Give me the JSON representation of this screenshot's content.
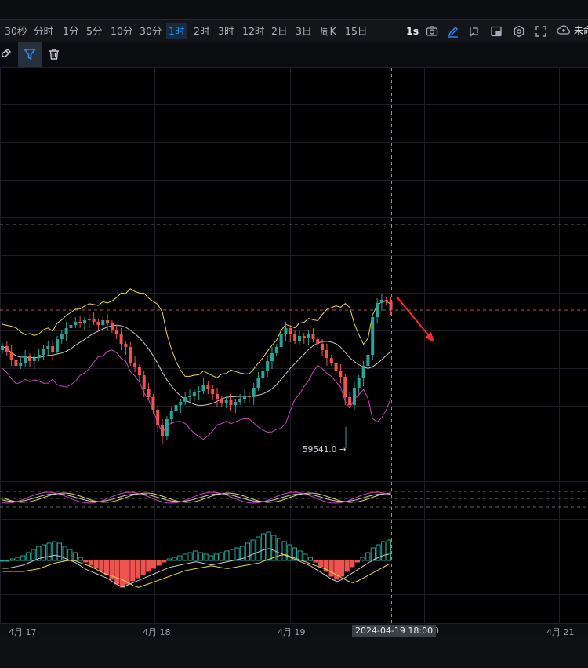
{
  "toolbar": {
    "timeframes": [
      {
        "label": "30秒"
      },
      {
        "label": "分时"
      },
      {
        "label": "1分"
      },
      {
        "label": "5分"
      },
      {
        "label": "10分"
      },
      {
        "label": "30分"
      },
      {
        "label": "1时",
        "active": true
      },
      {
        "label": "2时"
      },
      {
        "label": "3时"
      },
      {
        "label": "12时"
      },
      {
        "label": "2日"
      },
      {
        "label": "3日"
      },
      {
        "label": "周K"
      },
      {
        "label": "15日"
      }
    ],
    "interval_label": "1s",
    "cloud_label": "未命",
    "icons": [
      "camera-icon",
      "pen-icon",
      "crop-icon",
      "layout-icon",
      "settings-icon",
      "fullscreen-icon",
      "cloud-icon"
    ]
  },
  "subtoolbar": {
    "icons": [
      "magnet-icon",
      "filter-icon",
      "trash-icon"
    ]
  },
  "chart": {
    "low_marker_label": "59541.0 →",
    "colors": {
      "up": "#26a69a",
      "down": "#ef5350",
      "boll_upper": "#e8d44d",
      "boll_mid": "#c9c9c9",
      "boll_lower": "#c048b8",
      "arrow": "#ff2a2a"
    }
  },
  "xaxis": {
    "labels": [
      "4月 17",
      "4月 18",
      "4月 19",
      "20",
      "4月 21"
    ],
    "crosshair_label": "2024-04-19 18:00"
  }
}
